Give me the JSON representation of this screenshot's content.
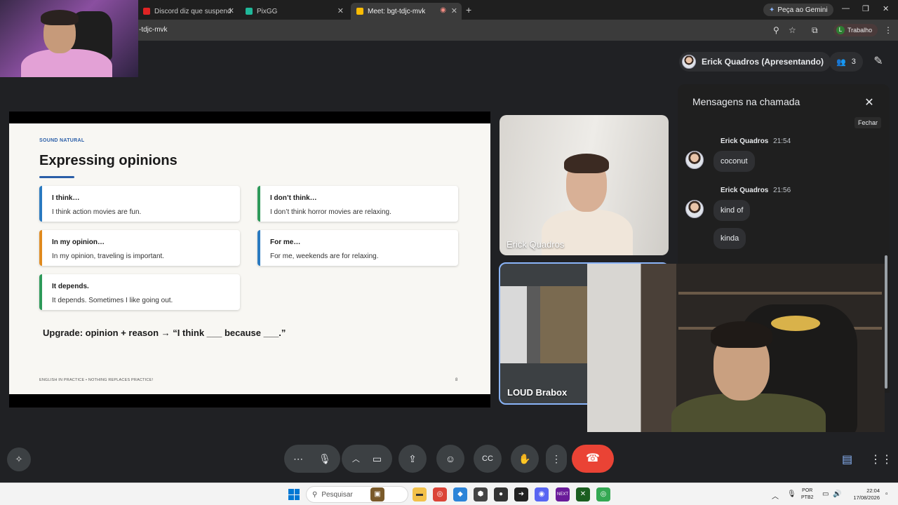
{
  "browser": {
    "tabs": [
      {
        "label": "Discord diz que suspendeu live",
        "favicon_color": "#e02424"
      },
      {
        "label": "PixGG",
        "favicon_color": "#1fb89a"
      },
      {
        "label": "Meet: bgt-tdjc-mvk",
        "favicon_color": "#fbbc04"
      }
    ],
    "gemini_label": "Peça ao Gemini",
    "url": "-tdjc-mvk",
    "profile_label": "Trabalho",
    "profile_initial": "L"
  },
  "meet": {
    "presenter_label": "Erick Quadros (Apresentando)",
    "participant_count": "3",
    "slide": {
      "kicker": "SOUND NATURAL",
      "title": "Expressing opinions",
      "cards": [
        {
          "heading": "I think…",
          "example": "I think action movies are fun.",
          "color": "#2a7ac0"
        },
        {
          "heading": "I don’t think…",
          "example": "I don’t think horror movies are relaxing.",
          "color": "#2e9a5a"
        },
        {
          "heading": "In my opinion…",
          "example": "In my opinion, traveling is important.",
          "color": "#e08a1e"
        },
        {
          "heading": "For me…",
          "example": "For me, weekends are for relaxing.",
          "color": "#2a7ac0"
        },
        {
          "heading": "It depends.",
          "example": "It depends. Sometimes I like going out.",
          "color": "#2e9a5a"
        }
      ],
      "upgrade": "Upgrade: opinion + reason → “I think ___ because ___.”",
      "footer": "ENGLISH IN PRACTICE  •  NOTHING REPLACES PRACTICE!",
      "page_number": "8"
    },
    "tiles": [
      {
        "name": "Erick Quadros"
      },
      {
        "name": "LOUD Brabox"
      }
    ],
    "chat": {
      "title": "Mensagens na chamada",
      "close_tooltip": "Fechar",
      "groups": [
        {
          "sender": "Erick Quadros",
          "time": "21:54",
          "messages": [
            "coconut"
          ]
        },
        {
          "sender": "Erick Quadros",
          "time": "21:56",
          "messages": [
            "kind of",
            "kinda"
          ]
        }
      ]
    }
  },
  "taskbar": {
    "search_placeholder": "Pesquisar",
    "lang_line1": "POR",
    "lang_line2": "PTB2",
    "time": "22:04",
    "date": "17/08/2026"
  }
}
